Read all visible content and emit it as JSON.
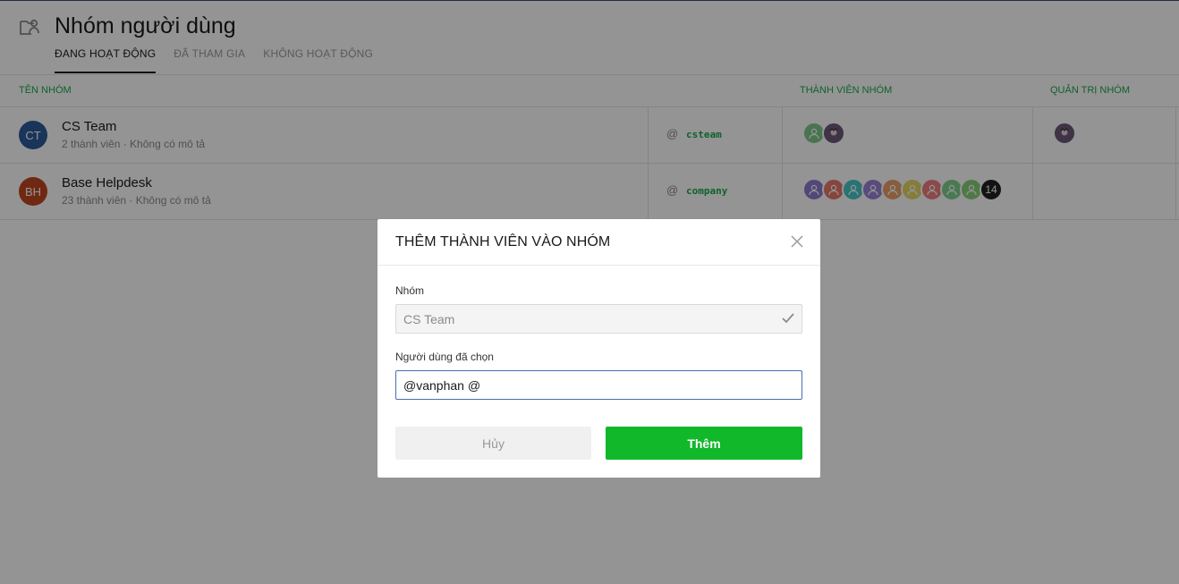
{
  "header": {
    "title": "Nhóm người dùng",
    "tabs": [
      {
        "label": "ĐANG HOẠT ĐỘNG",
        "active": true
      },
      {
        "label": "ĐÃ THAM GIA",
        "active": false
      },
      {
        "label": "KHÔNG HOẠT ĐỘNG",
        "active": false
      }
    ]
  },
  "columns": {
    "group_name": "TÊN NHÓM",
    "members": "THÀNH VIÊN NHÓM",
    "admins": "QUẢN TRỊ NHÓM"
  },
  "groups": [
    {
      "initials": "CT",
      "avatar_color": "#2e5a9c",
      "name": "CS Team",
      "description": "2 thành viên · Không có mô tả",
      "at": "@",
      "handle": "csteam",
      "member_avatars": [
        "#7fc98a",
        "#6b5a78"
      ],
      "member_overflow": "",
      "admin_avatars": [
        "#6b5a78"
      ]
    },
    {
      "initials": "BH",
      "avatar_color": "#c0471f",
      "name": "Base Helpdesk",
      "description": "23 thành viên · Không có mô tả",
      "at": "@",
      "handle": "company",
      "member_avatars": [
        "#8f7bd1",
        "#e7776a",
        "#47c6c9",
        "#9a84d6",
        "#e8a06a",
        "#e3d767",
        "#f07e7e",
        "#7fd18f",
        "#8bcf7a"
      ],
      "member_overflow": "14",
      "admin_avatars": []
    }
  ],
  "modal": {
    "title": "THÊM THÀNH VIÊN VÀO NHÓM",
    "group_label": "Nhóm",
    "group_value": "CS Team",
    "users_label": "Người dùng đã chọn",
    "users_value": "@vanphan @",
    "cancel_label": "Hủy",
    "submit_label": "Thêm"
  },
  "colors": {
    "accent_green": "#1aa84a",
    "button_green": "#11b82a"
  }
}
